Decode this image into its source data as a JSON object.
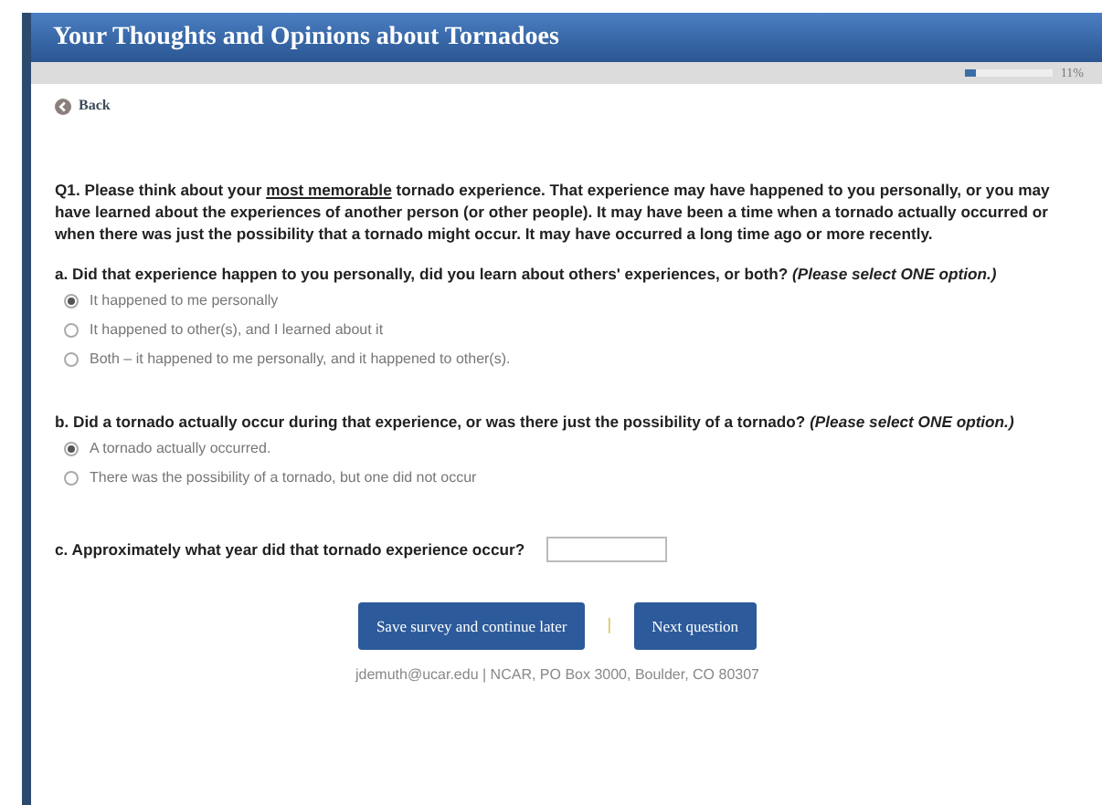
{
  "header": {
    "title": "Your Thoughts and Opinions about Tornadoes"
  },
  "progress": {
    "level": 0.11,
    "reading": "11%"
  },
  "back": {
    "label": "Back"
  },
  "intro": "Q1. Please think about your **most memorable** tornado experience.  That experience may have happened to you personally, or you may have learned about the experiences of another person (or other people). It may have been a time when a tornado actually occurred or when there was just the possibility that a tornado might occur. It may have occurred a long time ago or more recently.",
  "questions": [
    {
      "kind": "choice",
      "prompt": "a. Did that experience happen to you personally, did you learn about others' experiences, or both?",
      "hint": "(Please select ONE option.)",
      "options": [
        {
          "label": "It happened to me personally",
          "selected": true
        },
        {
          "label": "It happened to other(s), and I learned about it",
          "selected": false
        },
        {
          "label": "Both – it happened to me personally, and it happened to other(s).",
          "selected": false
        }
      ]
    },
    {
      "kind": "choice",
      "prompt": "b. Did a tornado actually occur during that experience, or was there just the possibility of a tornado?",
      "hint": "(Please select ONE option.)",
      "options": [
        {
          "label": "A tornado actually occurred.",
          "selected": true
        },
        {
          "label": "There was the possibility of a tornado, but one did not occur",
          "selected": false
        }
      ]
    },
    {
      "kind": "text",
      "prompt": "c. Approximately what year did that tornado experience occur?"
    }
  ],
  "buttons": {
    "save": "Save survey and continue later",
    "separator": "|",
    "next": "Next question"
  },
  "footer": "jdemuth@ucar.edu | NCAR, PO Box 3000, Boulder, CO 80307"
}
